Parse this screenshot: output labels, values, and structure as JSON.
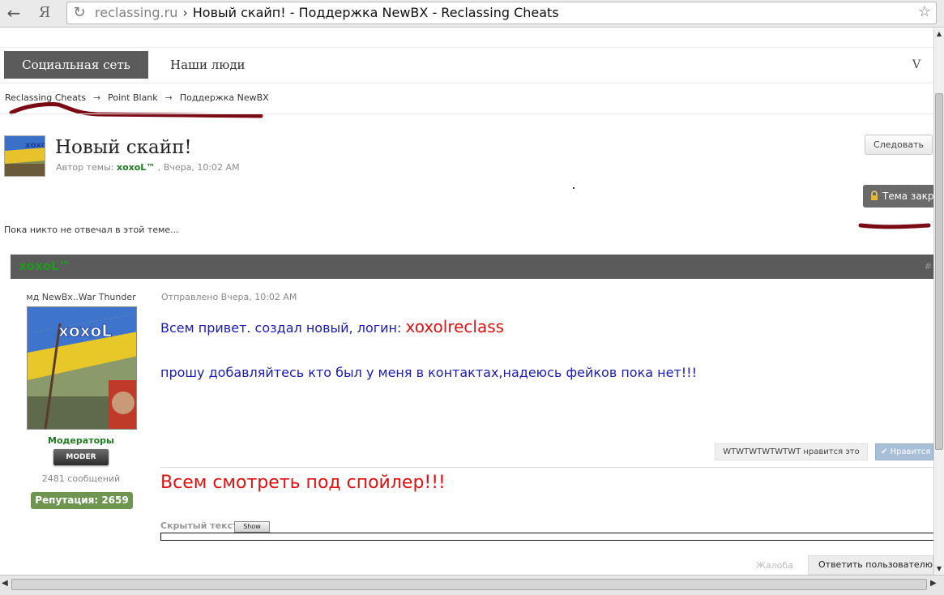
{
  "browser": {
    "back_icon": "←",
    "yandex_icon": "Я",
    "reload_icon": "↻",
    "domain": "reclassing.ru",
    "separator": "›",
    "page_title": "Новый скайп! - Поддержка NewBX - Reclassing Cheats",
    "star_icon": "☆"
  },
  "nav": {
    "social_tab": "Социальная сеть",
    "people_tab": "Наши люди",
    "more_tab": "V"
  },
  "breadcrumbs": [
    {
      "label": "Reclassing Cheats"
    },
    {
      "label": "Point Blank"
    },
    {
      "label": "Поддержка NewBX"
    }
  ],
  "breadcrumb_arrow": "→",
  "topic": {
    "title": "Новый скайп!",
    "author_prefix": "Автор темы:",
    "author": "xoxoL™",
    "date": ", Вчера, 10:02 AM",
    "follow": "Следовать",
    "closed": "Тема закр",
    "no_replies": "Пока никто не отвечал в этой теме..."
  },
  "post": {
    "username": "xoxoL™",
    "post_num": "#",
    "author_title": "мд NewBx..War Thunder",
    "group": "Модераторы",
    "badge": "MODER",
    "message_count": "2481 сообщений",
    "reputation": "Репутация: 2659",
    "posted": "Отправлено Вчера, 10:02 AM",
    "line1": "Всем привет. создал новый, логин: ",
    "login": "xoxolreclass",
    "line2": "прошу добавляйтесь  кто был у меня в контактах,надеюсь фейков пока нет!!!",
    "likes_text": "WTWTWTWTWTWT нравится это",
    "like_button": "Нравится",
    "spoiler_call": "Всем смотреть под спойлер!!!",
    "hidden_label": "Скрытый текст",
    "show_button": "Show",
    "report": "Жалоба",
    "reply": "Ответить пользователю"
  },
  "colors": {
    "nav_active": "#5b5b5b",
    "author_green": "#1e7a1e",
    "post_blue": "#1a1ab8",
    "post_red": "#e01010",
    "reputation_green": "#6f9550",
    "annotation_marker": "#7a0a14"
  }
}
